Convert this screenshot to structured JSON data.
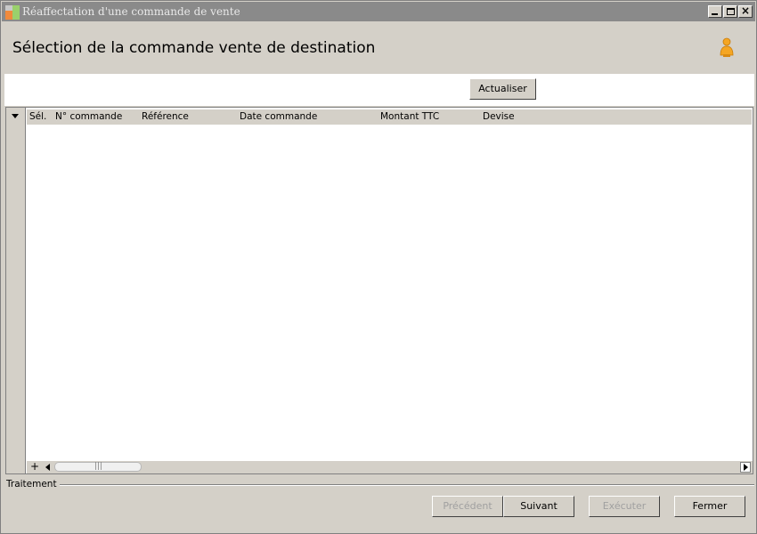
{
  "window": {
    "title": "Réaffectation d'une commande de vente",
    "controls": [
      "minimize",
      "maximize",
      "close"
    ]
  },
  "header": {
    "title": "Sélection de la commande vente de destination",
    "icon": "user-icon"
  },
  "toolbar": {
    "refresh_label": "Actualiser"
  },
  "grid": {
    "columns": [
      "Sél.",
      "N° commande",
      "Référence",
      "Date commande",
      "Montant TTC",
      "Devise"
    ],
    "rows": [],
    "hscroll_plus": "+",
    "hscroll_grip": "|||"
  },
  "footer": {
    "group_label": "Traitement",
    "buttons": {
      "previous": "Précédent",
      "next": "Suivant",
      "execute": "Exécuter",
      "close": "Fermer"
    }
  },
  "colors": {
    "titlebar_inactive": "#8a8a8a",
    "window_bg": "#d4d0c8",
    "disabled_text": "#a0a0a0",
    "user_icon": "#f5a623"
  }
}
